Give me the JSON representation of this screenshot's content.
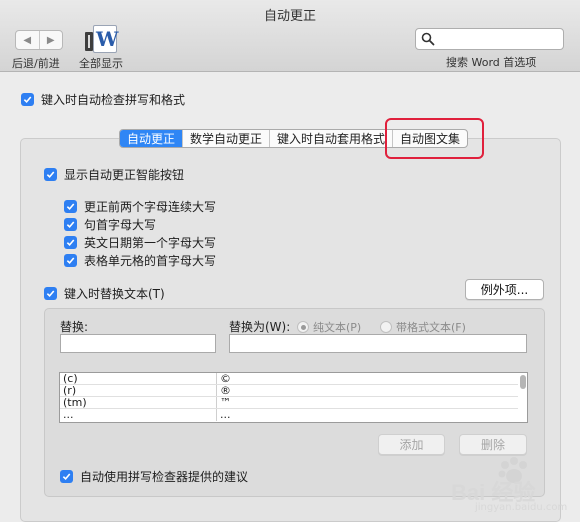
{
  "window": {
    "title": "自动更正"
  },
  "toolbar": {
    "nav_label": "后退/前进",
    "show_all_label": "全部显示",
    "search_label": "搜索 Word 首选项",
    "search_placeholder": ""
  },
  "top_option": {
    "label": "键入时自动检查拼写和格式",
    "checked": true
  },
  "tabs": [
    {
      "label": "自动更正",
      "active": true
    },
    {
      "label": "数学自动更正",
      "active": false
    },
    {
      "label": "键入时自动套用格式",
      "active": false
    },
    {
      "label": "自动图文集",
      "active": false,
      "highlighted": true
    }
  ],
  "autocorrect": {
    "show_buttons": {
      "label": "显示自动更正智能按钮",
      "checked": true
    },
    "options": [
      {
        "label": "更正前两个字母连续大写",
        "checked": true
      },
      {
        "label": "句首字母大写",
        "checked": true
      },
      {
        "label": "英文日期第一个字母大写",
        "checked": true
      },
      {
        "label": "表格单元格的首字母大写",
        "checked": true
      }
    ],
    "replace_text": {
      "label": "键入时替换文本(T)",
      "checked": true
    },
    "exceptions_button": "例外项...",
    "replace_label": "替换:",
    "replace_with_label": "替换为(W):",
    "radio_plain": {
      "label": "纯文本(P)",
      "selected": true
    },
    "radio_formatted": {
      "label": "带格式文本(F)",
      "selected": false
    },
    "replace_value": "",
    "replace_with_value": "",
    "table_rows": [
      {
        "from": "(c)",
        "to": "©"
      },
      {
        "from": "(r)",
        "to": "®"
      },
      {
        "from": "(tm)",
        "to": "™"
      },
      {
        "from": "...",
        "to": "..."
      }
    ],
    "add_button": "添加",
    "delete_button": "删除",
    "spellcheck_suggest": {
      "label": "自动使用拼写检查器提供的建议",
      "checked": true
    }
  },
  "watermark": {
    "text": "Bai 经验",
    "url": "jingyan.baidu.com"
  },
  "colors": {
    "accent": "#2f86f5",
    "highlight": "#e0203c"
  },
  "icons": {
    "back": "chevron-left-icon",
    "forward": "chevron-right-icon",
    "show_all": "word-prefs-icon",
    "search": "search-icon",
    "check": "checkmark-icon"
  }
}
